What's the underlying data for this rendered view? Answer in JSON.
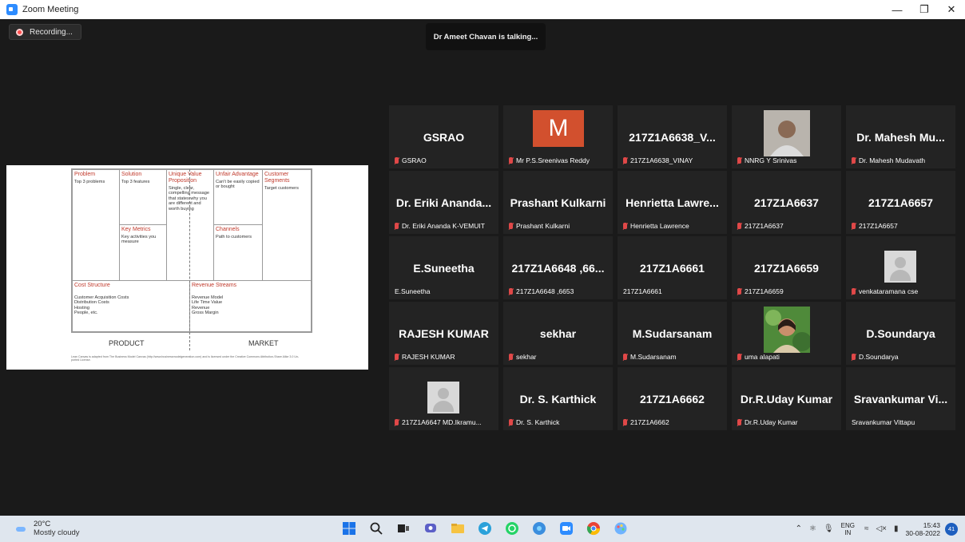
{
  "window": {
    "title": "Zoom Meeting"
  },
  "meeting": {
    "recording_label": "Recording...",
    "talking_banner": "Dr Ameet Chavan is talking..."
  },
  "lean_canvas": {
    "problem": {
      "title": "Problem",
      "text": "Top 3 problems"
    },
    "solution": {
      "title": "Solution",
      "text": "Top 3 features"
    },
    "uvp": {
      "title": "Unique Value Proposition",
      "text": "Single, clear, compelling message that states why you are different and worth buying"
    },
    "advantage": {
      "title": "Unfair Advantage",
      "text": "Can't be easily copied or bought"
    },
    "segments": {
      "title": "Customer Segments",
      "text": "Target customers"
    },
    "metrics": {
      "title": "Key Metrics",
      "text": "Key activities you measure"
    },
    "channels": {
      "title": "Channels",
      "text": "Path to customers"
    },
    "costs": {
      "title": "Cost Structure",
      "lines": [
        "Customer Acquisition Costs",
        "Distribution Costs",
        "Hosting",
        "People, etc."
      ]
    },
    "revenue": {
      "title": "Revenue Streams",
      "lines": [
        "Revenue Model",
        "Life Time Value",
        "Revenue",
        "Gross Margin"
      ]
    },
    "product_label": "PRODUCT",
    "market_label": "MARKET",
    "footnote": "Lean Canvas is adapted from The Business Model Canvas (http://www.businessmodelgeneration.com) and is licensed under the Creative Commons Attribution-Share Alike 3.0 Un-ported License."
  },
  "participants": [
    {
      "name": "GSRAO",
      "label": "GSRAO",
      "muted": true,
      "visual": "name"
    },
    {
      "name": "M",
      "label": "Mr P.S.Sreenivas Reddy",
      "muted": true,
      "visual": "initial"
    },
    {
      "name": "217Z1A6638_V...",
      "label": "217Z1A6638_VINAY",
      "muted": true,
      "visual": "name"
    },
    {
      "name": "",
      "label": "NNRG Y Srinivas",
      "muted": true,
      "visual": "photo"
    },
    {
      "name": "Dr. Mahesh Mu...",
      "label": "Dr. Mahesh Mudavath",
      "muted": true,
      "visual": "name"
    },
    {
      "name": "Dr. Eriki Ananda...",
      "label": "Dr. Eriki Ananda K-VEMUIT",
      "muted": true,
      "visual": "name"
    },
    {
      "name": "Prashant Kulkarni",
      "label": "Prashant Kulkarni",
      "muted": true,
      "visual": "name"
    },
    {
      "name": "Henrietta Lawre...",
      "label": "Henrietta Lawrence",
      "muted": true,
      "visual": "name"
    },
    {
      "name": "217Z1A6637",
      "label": "217Z1A6637",
      "muted": true,
      "visual": "name"
    },
    {
      "name": "217Z1A6657",
      "label": "217Z1A6657",
      "muted": true,
      "visual": "name"
    },
    {
      "name": "E.Suneetha",
      "label": "E.Suneetha",
      "muted": false,
      "visual": "name"
    },
    {
      "name": "217Z1A6648 ,66...",
      "label": "217Z1A6648 ,6653",
      "muted": true,
      "visual": "name"
    },
    {
      "name": "217Z1A6661",
      "label": "217Z1A6661",
      "muted": false,
      "visual": "name"
    },
    {
      "name": "217Z1A6659",
      "label": "217Z1A6659",
      "muted": true,
      "visual": "name"
    },
    {
      "name": "",
      "label": "venkataramana cse",
      "muted": true,
      "visual": "placeholder"
    },
    {
      "name": "RAJESH KUMAR",
      "label": "RAJESH KUMAR",
      "muted": true,
      "visual": "name"
    },
    {
      "name": "sekhar",
      "label": "sekhar",
      "muted": true,
      "visual": "name"
    },
    {
      "name": "M.Sudarsanam",
      "label": "M.Sudarsanam",
      "muted": true,
      "visual": "name"
    },
    {
      "name": "",
      "label": "uma alapati",
      "muted": true,
      "visual": "photo2"
    },
    {
      "name": "D.Soundarya",
      "label": "D.Soundarya",
      "muted": true,
      "visual": "name"
    },
    {
      "name": "",
      "label": "217Z1A6647 MD.Ikramu...",
      "muted": true,
      "visual": "placeholder"
    },
    {
      "name": "Dr. S. Karthick",
      "label": "Dr. S. Karthick",
      "muted": true,
      "visual": "name"
    },
    {
      "name": "217Z1A6662",
      "label": "217Z1A6662",
      "muted": true,
      "visual": "name"
    },
    {
      "name": "Dr.R.Uday Kumar",
      "label": "Dr.R.Uday Kumar",
      "muted": true,
      "visual": "name"
    },
    {
      "name": "Sravankumar Vi...",
      "label": "Sravankumar Vittapu",
      "muted": false,
      "visual": "name"
    }
  ],
  "taskbar": {
    "temperature": "20°C",
    "weather": "Mostly cloudy",
    "lang_top": "ENG",
    "lang_bottom": "IN",
    "time": "15:43",
    "date": "30-08-2022",
    "notification_count": "41",
    "pinned_icons": [
      "windows-start-icon",
      "search-icon",
      "task-view-icon",
      "teams-chat-icon",
      "file-explorer-icon",
      "telegram-icon",
      "whatsapp-icon",
      "network-app-icon",
      "zoom-icon",
      "chrome-icon",
      "paint-icon"
    ]
  },
  "colors": {
    "stage": "#1a1a1a",
    "tile": "#232323",
    "muted": "#e04848",
    "accent": "#2d8cff",
    "canvas_heading": "#c0392b"
  }
}
